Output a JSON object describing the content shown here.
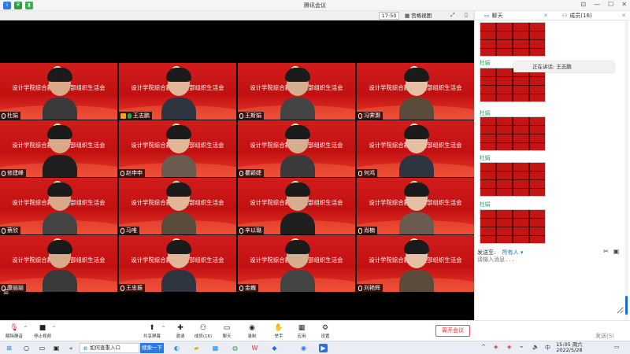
{
  "window": {
    "title": "腾讯会议"
  },
  "stage_bar": {
    "time": "17:50",
    "view_label": "宫格视图"
  },
  "tiles": [
    {
      "caption": "设计学院综合教师党支部组织生活会",
      "name": "杜娟",
      "mic": "muted"
    },
    {
      "caption": "设计学院综合教师党支部组织生活会",
      "name": "王志鹏",
      "mic": "speaking"
    },
    {
      "caption": "设计学院综合教师党支部组织生活会",
      "name": "王斯娟",
      "mic": "muted"
    },
    {
      "caption": "设计学院综合教师党支部组织生活会",
      "name": "冯霁灏",
      "mic": "muted"
    },
    {
      "caption": "设计学院综合教师党支部组织生活会",
      "name": "修建峰",
      "mic": "muted"
    },
    {
      "caption": "设计学院综合教师党支部组织生活会",
      "name": "赵申申",
      "mic": "muted"
    },
    {
      "caption": "设计学院综合教师党支部组织生活会",
      "name": "瞿颖婕",
      "mic": "muted"
    },
    {
      "caption": "设计学院综合教师党支部组织生活会",
      "name": "何鸿",
      "mic": "muted"
    },
    {
      "caption": "设计学院综合教师党支部组织生活会",
      "name": "蔡欣",
      "mic": "muted"
    },
    {
      "caption": "设计学院综合教师党支部组织生活会",
      "name": "马唯",
      "mic": "muted"
    },
    {
      "caption": "设计学院综合教师党支部组织生活会",
      "name": "辛以璐",
      "mic": "muted"
    },
    {
      "caption": "设计学院综合教师党支部组织生活会",
      "name": "肖楠",
      "mic": "muted"
    },
    {
      "caption": "设计学院综合教师党支部组织生活会",
      "name": "康丽丽",
      "mic": "muted"
    },
    {
      "caption": "设计学院综合教师党支部组织生活会",
      "name": "王忠振",
      "mic": "muted"
    },
    {
      "caption": "设计学院综合教师党支部组织生活会",
      "name": "金巍",
      "mic": "muted"
    },
    {
      "caption": "设计学院综合教师党支部组织生活会",
      "name": "刘艳辉",
      "mic": "muted"
    }
  ],
  "panel": {
    "chat_tab": "聊天",
    "members_tab": "成员(16)",
    "messages": [
      {
        "sender": ""
      },
      {
        "sender": "杜娟"
      },
      {
        "sender": "杜娟"
      },
      {
        "sender": "杜娟"
      },
      {
        "sender": "杜娟"
      }
    ],
    "speaking_now": "正在讲话: 王志鹏",
    "send_to_label": "发送至:",
    "send_to_value": "所有人",
    "input_placeholder": "请输入消息...",
    "send_label": "发送(S)"
  },
  "toolbar": {
    "mute_label": "解除静音",
    "video_label": "停止视频",
    "share_label": "共享屏幕",
    "invite_label": "邀请",
    "members_label": "成员(16)",
    "chat_label": "聊天",
    "record_label": "录制",
    "raise_hand_label": "举手",
    "apps_label": "应用",
    "settings_label": "设置",
    "leave_label": "离开会议"
  },
  "taskbar": {
    "search_text": "如何查重入口",
    "search_button": "搜索一下",
    "time": "15:05 周六",
    "date": "2022/5/28"
  },
  "colors": {
    "accent": "#1a6fd6",
    "tile_red": "#c21010",
    "leave_red": "#e03131",
    "sender_green": "#1aa45c"
  }
}
